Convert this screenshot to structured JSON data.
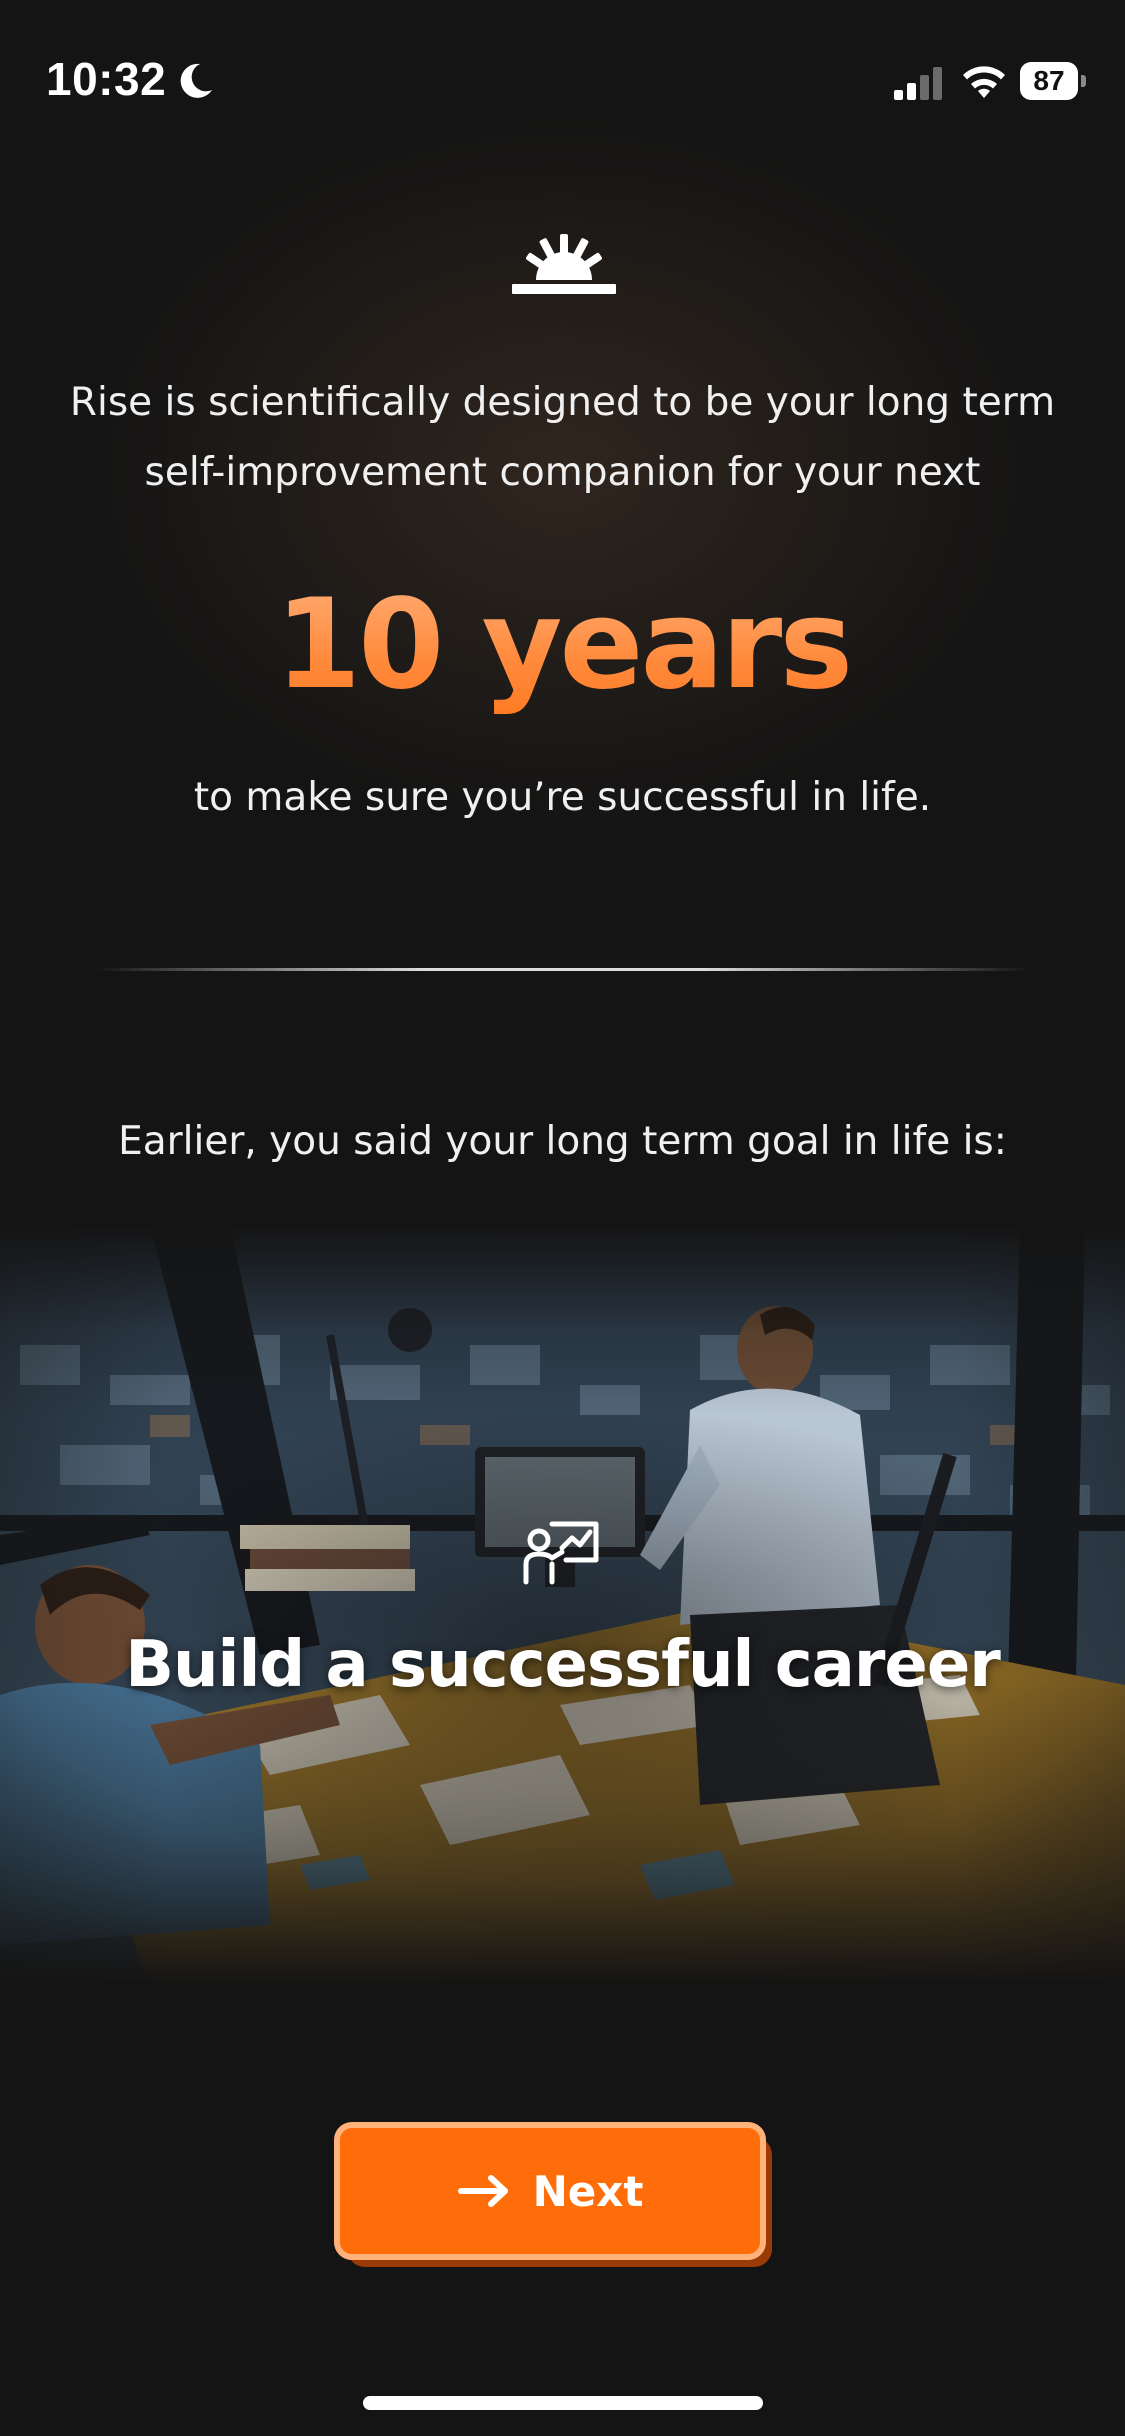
{
  "status_bar": {
    "time": "10:32",
    "battery_level": "87",
    "icons": [
      "moon-icon",
      "cellular-signal-icon",
      "wifi-icon",
      "battery-icon"
    ]
  },
  "logo": {
    "icon": "rising-sun-logo-icon"
  },
  "intro": {
    "text": "Rise is scientifically designed to be your long term self-improvement companion for your next",
    "highlight": "10 years",
    "subtext": "to make sure you’re successful in life."
  },
  "goal": {
    "intro": "Earlier, you said your long term goal in life is:",
    "icon": "career-presentation-icon",
    "title": "Build a successful career"
  },
  "next_button": {
    "label": "Next",
    "icon": "arrow-right-icon"
  },
  "colors": {
    "background": "#141414",
    "accent": "#ff6d0a",
    "accent_border": "#ffb27a",
    "highlight_gradient_top": "#ffb07a",
    "highlight_gradient_bottom": "#ff7a22"
  }
}
